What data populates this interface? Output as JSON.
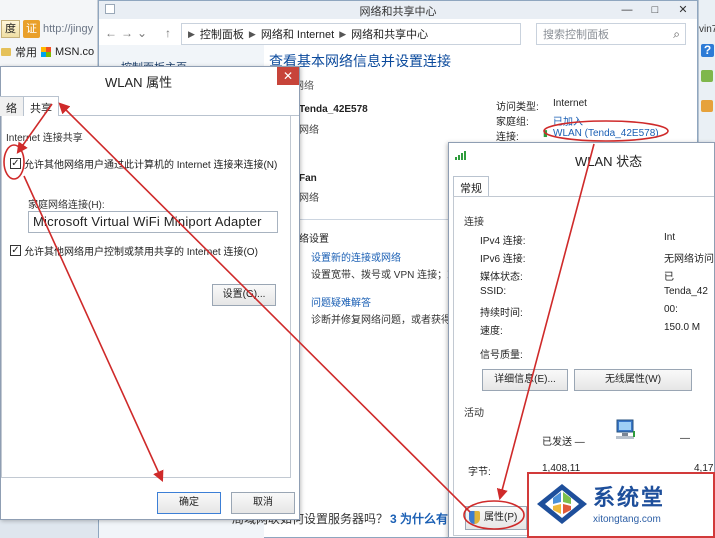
{
  "browser": {
    "btn1": "度",
    "btn2": "证",
    "url": "http://jingy",
    "fav1": "常用",
    "fav2": "MSN.co"
  },
  "nsc": {
    "window_title": "网络和共享中心",
    "controls": {
      "minimize": "—",
      "maximize": "□",
      "close": "✕"
    },
    "nav": {
      "back": "←",
      "forward": "→",
      "dropdown": "⌄",
      "up": "↑"
    },
    "breadcrumb": [
      "控制面板",
      "网络和 Internet",
      "网络和共享中心"
    ],
    "search_placeholder": "搜索控制面板",
    "left_home": "控制面板主页",
    "heading": "查看基本网络信息并设置连接",
    "subhead": "网络",
    "net1_name": "Tenda_42E578",
    "net1_type": "网络",
    "net2_name": "Fan",
    "net2_type": "网络",
    "access_type_label": "访问类型:",
    "access_type_value": "Internet",
    "homegroup_label": "家庭组:",
    "homegroup_value": "已加入",
    "connections_label": "连接:",
    "connections_value": "WLAN (Tenda_42E578)",
    "change_header": "络设置",
    "task1_link": "设置新的连接或网络",
    "task1_desc": "设置宽带、拨号或 VPN 连接；或",
    "task2_link": "问题疑难解答",
    "task2_desc": "诊断并修复网络问题，或者获得疑",
    "bottom_left": "局域网联如何设置服务器吗？",
    "bottom_q3": "3 为什么有"
  },
  "edge": {
    "frag": "vin7"
  },
  "props": {
    "title": "WLAN 属性",
    "close": "✕",
    "tab_prev": "络",
    "tab_share": "共享",
    "group_title": "Internet 连接共享",
    "allow_share": "允许其他网络用户通过此计算机的 Internet 连接来连接(N)",
    "home_conn_label": "家庭网络连接(H):",
    "adapter_value": "Microsoft Virtual WiFi Miniport Adapter",
    "allow_control": "允许其他网络用户控制或禁用共享的 Internet 连接(O)",
    "settings_btn": "设置(G)...",
    "ok_btn": "确定",
    "cancel_btn": "取消"
  },
  "status": {
    "title": "WLAN 状态",
    "tab": "常规",
    "connection_section": "连接",
    "rows": [
      {
        "label": "IPv4 连接:",
        "value": "Int"
      },
      {
        "label": "IPv6 连接:",
        "value": "无网络访问"
      },
      {
        "label": "媒体状态:",
        "value": "已"
      },
      {
        "label": "SSID:",
        "value": "Tenda_42"
      },
      {
        "label": "持续时间:",
        "value": "00:"
      },
      {
        "label": "速度:",
        "value": "150.0 M"
      }
    ],
    "signal_label": "信号质量:",
    "details_btn": "详细信息(E)...",
    "wireless_btn": "无线属性(W)",
    "activity_section": "活动",
    "sent_label": "已发送 —",
    "bytes_label": "字节:",
    "bytes_sent": "1,408,11",
    "bytes_recv": "4,17",
    "properties_btn": "属性(P)"
  },
  "watermark": {
    "cn": "系统堂",
    "en": "xitongtang.com"
  },
  "colors": {
    "arrow": "#cf2a2a",
    "link": "#1a5fb4",
    "heading": "#0b4a9c"
  }
}
